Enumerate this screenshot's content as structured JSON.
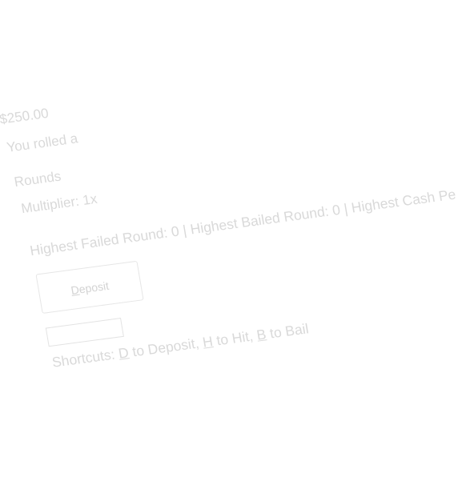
{
  "status": {
    "balance": "$250.00",
    "rolled": "You rolled a",
    "rounds": "Rounds",
    "multiplier": "Multiplier: 1x",
    "highest": "Highest Failed Round: 0 | Highest Bailed Round: 0 | Highest Cash Pe"
  },
  "controls": {
    "deposit_label_key": "D",
    "deposit_label_rest": "eposit",
    "amount_value": ""
  },
  "shortcuts": {
    "prefix": "Shortcuts: ",
    "d_key": "D",
    "d_text": " to Deposit, ",
    "h_key": "H",
    "h_text": " to Hit, ",
    "b_key": "B",
    "b_text": " to Bail"
  },
  "colors": {
    "text": "#d9d9d9",
    "border": "#e6e6e6",
    "background": "#ffffff"
  }
}
